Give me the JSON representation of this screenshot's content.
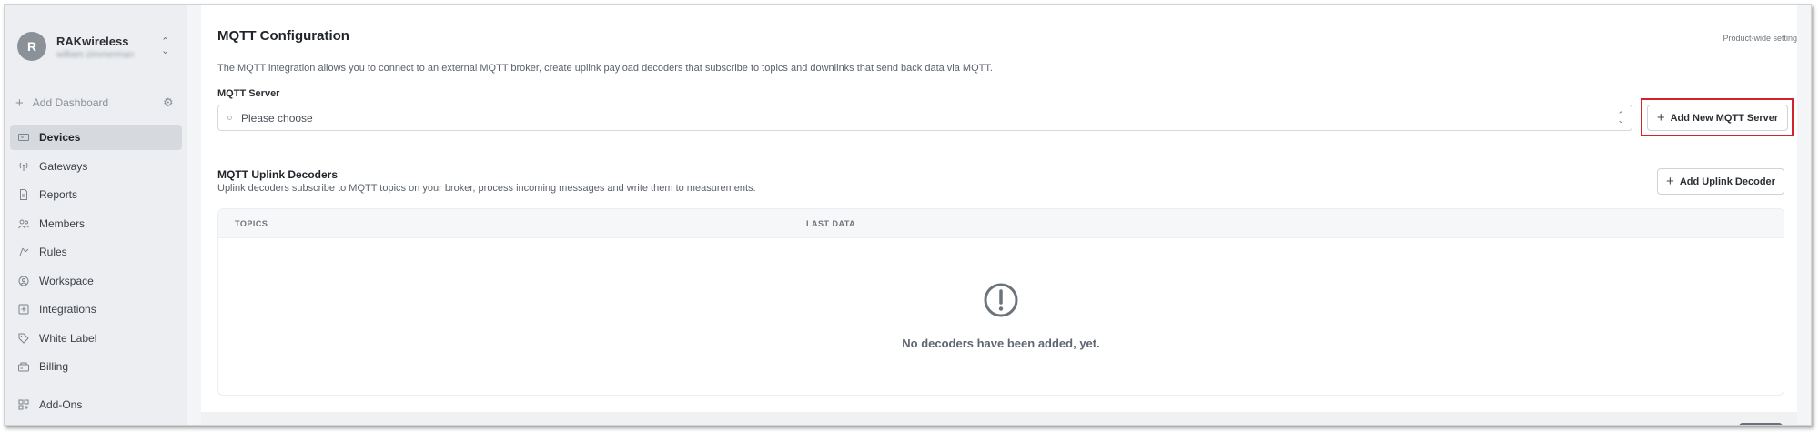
{
  "sidebar": {
    "org": {
      "avatar_letter": "R",
      "name": "RAKwireless",
      "user": "william zimmerman",
      "switch_icon": "chevron-updown-icon"
    },
    "add_dashboard": "Add Dashboard",
    "items": [
      {
        "label": "Devices",
        "icon": "device-icon",
        "active": true
      },
      {
        "label": "Gateways",
        "icon": "gateway-icon",
        "active": false
      },
      {
        "label": "Reports",
        "icon": "report-icon",
        "active": false
      },
      {
        "label": "Members",
        "icon": "members-icon",
        "active": false
      },
      {
        "label": "Rules",
        "icon": "rules-icon",
        "active": false
      },
      {
        "label": "Workspace",
        "icon": "workspace-icon",
        "active": false
      },
      {
        "label": "Integrations",
        "icon": "integrations-icon",
        "active": false
      },
      {
        "label": "White Label",
        "icon": "tag-icon",
        "active": false
      },
      {
        "label": "Billing",
        "icon": "billing-icon",
        "active": false
      },
      {
        "label": "Add-Ons",
        "icon": "addons-icon",
        "active": false
      }
    ]
  },
  "main": {
    "title": "MQTT Configuration",
    "product_wide": "Product-wide setting",
    "description": "The MQTT integration allows you to connect to an external MQTT broker, create uplink payload decoders that subscribe to topics and downlinks that send back data via MQTT.",
    "server_label": "MQTT Server",
    "server_placeholder": "Please choose",
    "add_server_button": "Add New MQTT Server",
    "decoders_title": "MQTT Uplink Decoders",
    "decoders_description": "Uplink decoders subscribe to MQTT topics on your broker, process incoming messages and write them to measurements.",
    "add_decoder_button": "Add Uplink Decoder",
    "table": {
      "columns": [
        "TOPICS",
        "LAST DATA"
      ],
      "empty_message": "No decoders have been added, yet."
    }
  },
  "colors": {
    "highlight": "#d0232b",
    "sidebar_bg": "#eceef1",
    "active_item_bg": "#d6d9de"
  }
}
